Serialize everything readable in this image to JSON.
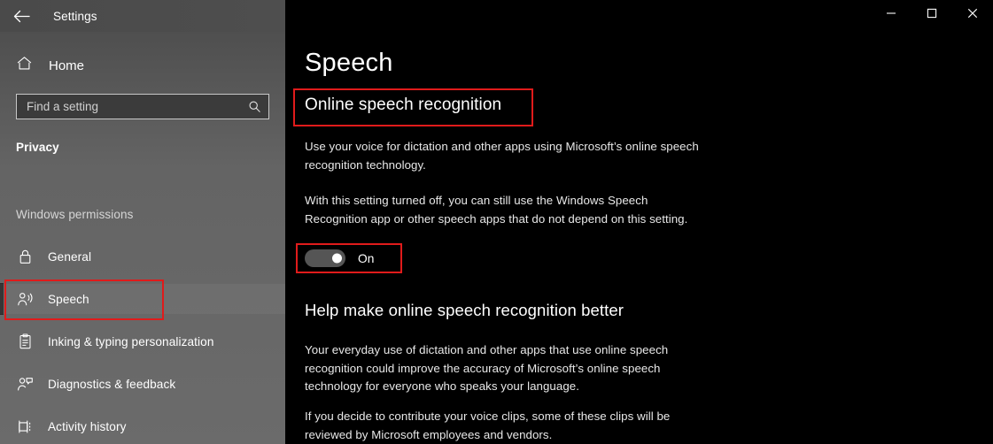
{
  "window": {
    "title": "Settings",
    "back_icon": "back-arrow-icon",
    "controls": {
      "minimize": "minimize-icon",
      "maximize": "maximize-icon",
      "close": "close-icon"
    }
  },
  "sidebar": {
    "home": {
      "label": "Home",
      "icon": "home-icon"
    },
    "search": {
      "placeholder": "Find a setting",
      "icon": "search-icon",
      "value": ""
    },
    "category": "Privacy",
    "group_heading": "Windows permissions",
    "items": [
      {
        "label": "General",
        "icon": "lock-icon",
        "selected": false
      },
      {
        "label": "Speech",
        "icon": "speech-person-icon",
        "selected": true
      },
      {
        "label": "Inking & typing personalization",
        "icon": "clipboard-pen-icon",
        "selected": false
      },
      {
        "label": "Diagnostics & feedback",
        "icon": "person-feedback-icon",
        "selected": false
      },
      {
        "label": "Activity history",
        "icon": "activity-history-icon",
        "selected": false
      }
    ]
  },
  "main": {
    "page_title": "Speech",
    "section_title": "Online speech recognition",
    "paragraph_1": "Use your voice for dictation and other apps using Microsoft’s online speech recognition technology.",
    "paragraph_2": "With this setting turned off, you can still use the Windows Speech Recognition app or other speech apps that do not depend on this setting.",
    "toggle": {
      "state_label": "On",
      "checked": true
    },
    "section_heading_2": "Help make online speech recognition better",
    "paragraph_3": "Your everyday use of dictation and other apps that use online speech recognition could improve the accuracy of Microsoft’s online speech technology for everyone who speaks your language.",
    "paragraph_4": "If you decide to contribute your voice clips, some of these clips will be reviewed by Microsoft employees and vendors."
  },
  "annotations": {
    "color": "#e01b1b",
    "boxes": [
      "section-title-highlight",
      "toggle-highlight",
      "sidebar-speech-highlight"
    ]
  },
  "scrollbar": {
    "orientation": "vertical"
  },
  "watermark": {
    "name": "cartoon-character-watermark"
  }
}
